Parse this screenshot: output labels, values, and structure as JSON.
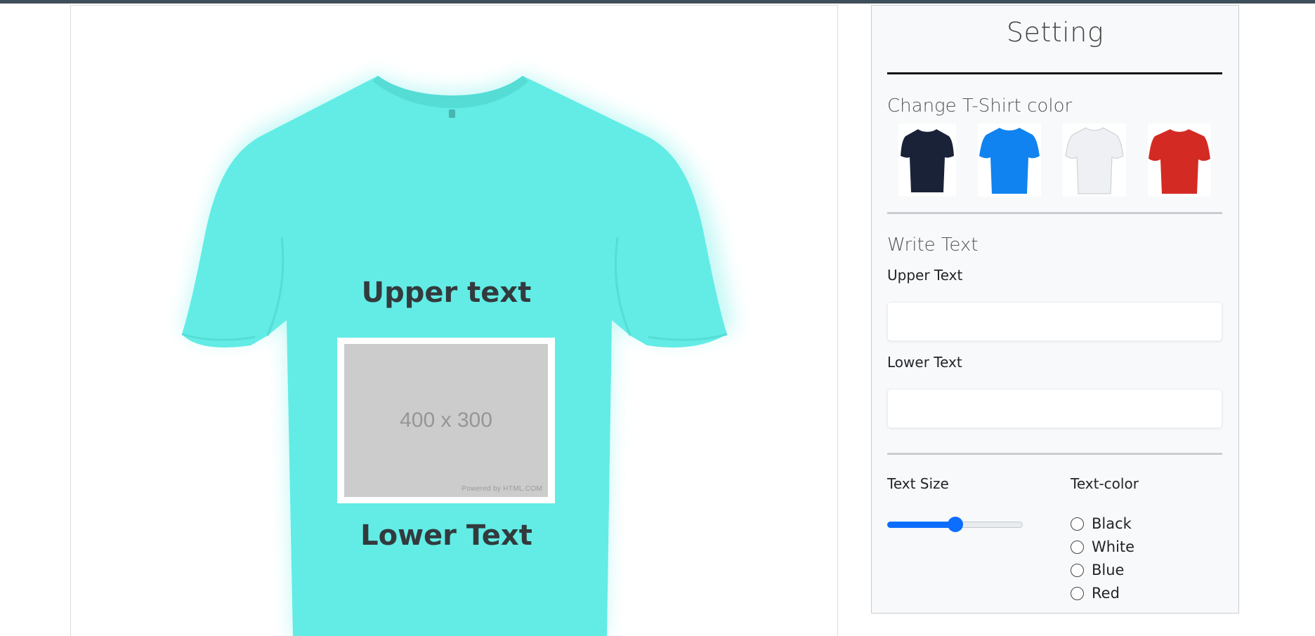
{
  "preview": {
    "shirt_color": "#62ece5",
    "upper_text": "Upper text",
    "lower_text": "Lower Text",
    "placeholder": {
      "size_label": "400 x 300",
      "powered_by": "Powered by HTML.COM"
    }
  },
  "settings": {
    "title": "Setting",
    "shirt_color_heading": "Change T-Shirt color",
    "swatches": [
      {
        "name": "navy",
        "color": "#1a2238"
      },
      {
        "name": "blue",
        "color": "#1083f0"
      },
      {
        "name": "white",
        "color": "#eef0f3"
      },
      {
        "name": "red",
        "color": "#d42a24"
      }
    ],
    "write_text_heading": "Write Text",
    "upper_text_label": "Upper Text",
    "upper_text_value": "",
    "lower_text_label": "Lower Text",
    "lower_text_value": "",
    "text_size_label": "Text Size",
    "text_size_fraction": 0.5,
    "text_color_label": "Text-color",
    "text_color_options": [
      "Black",
      "White",
      "Blue",
      "Red"
    ],
    "accent": "#0d6efd"
  }
}
